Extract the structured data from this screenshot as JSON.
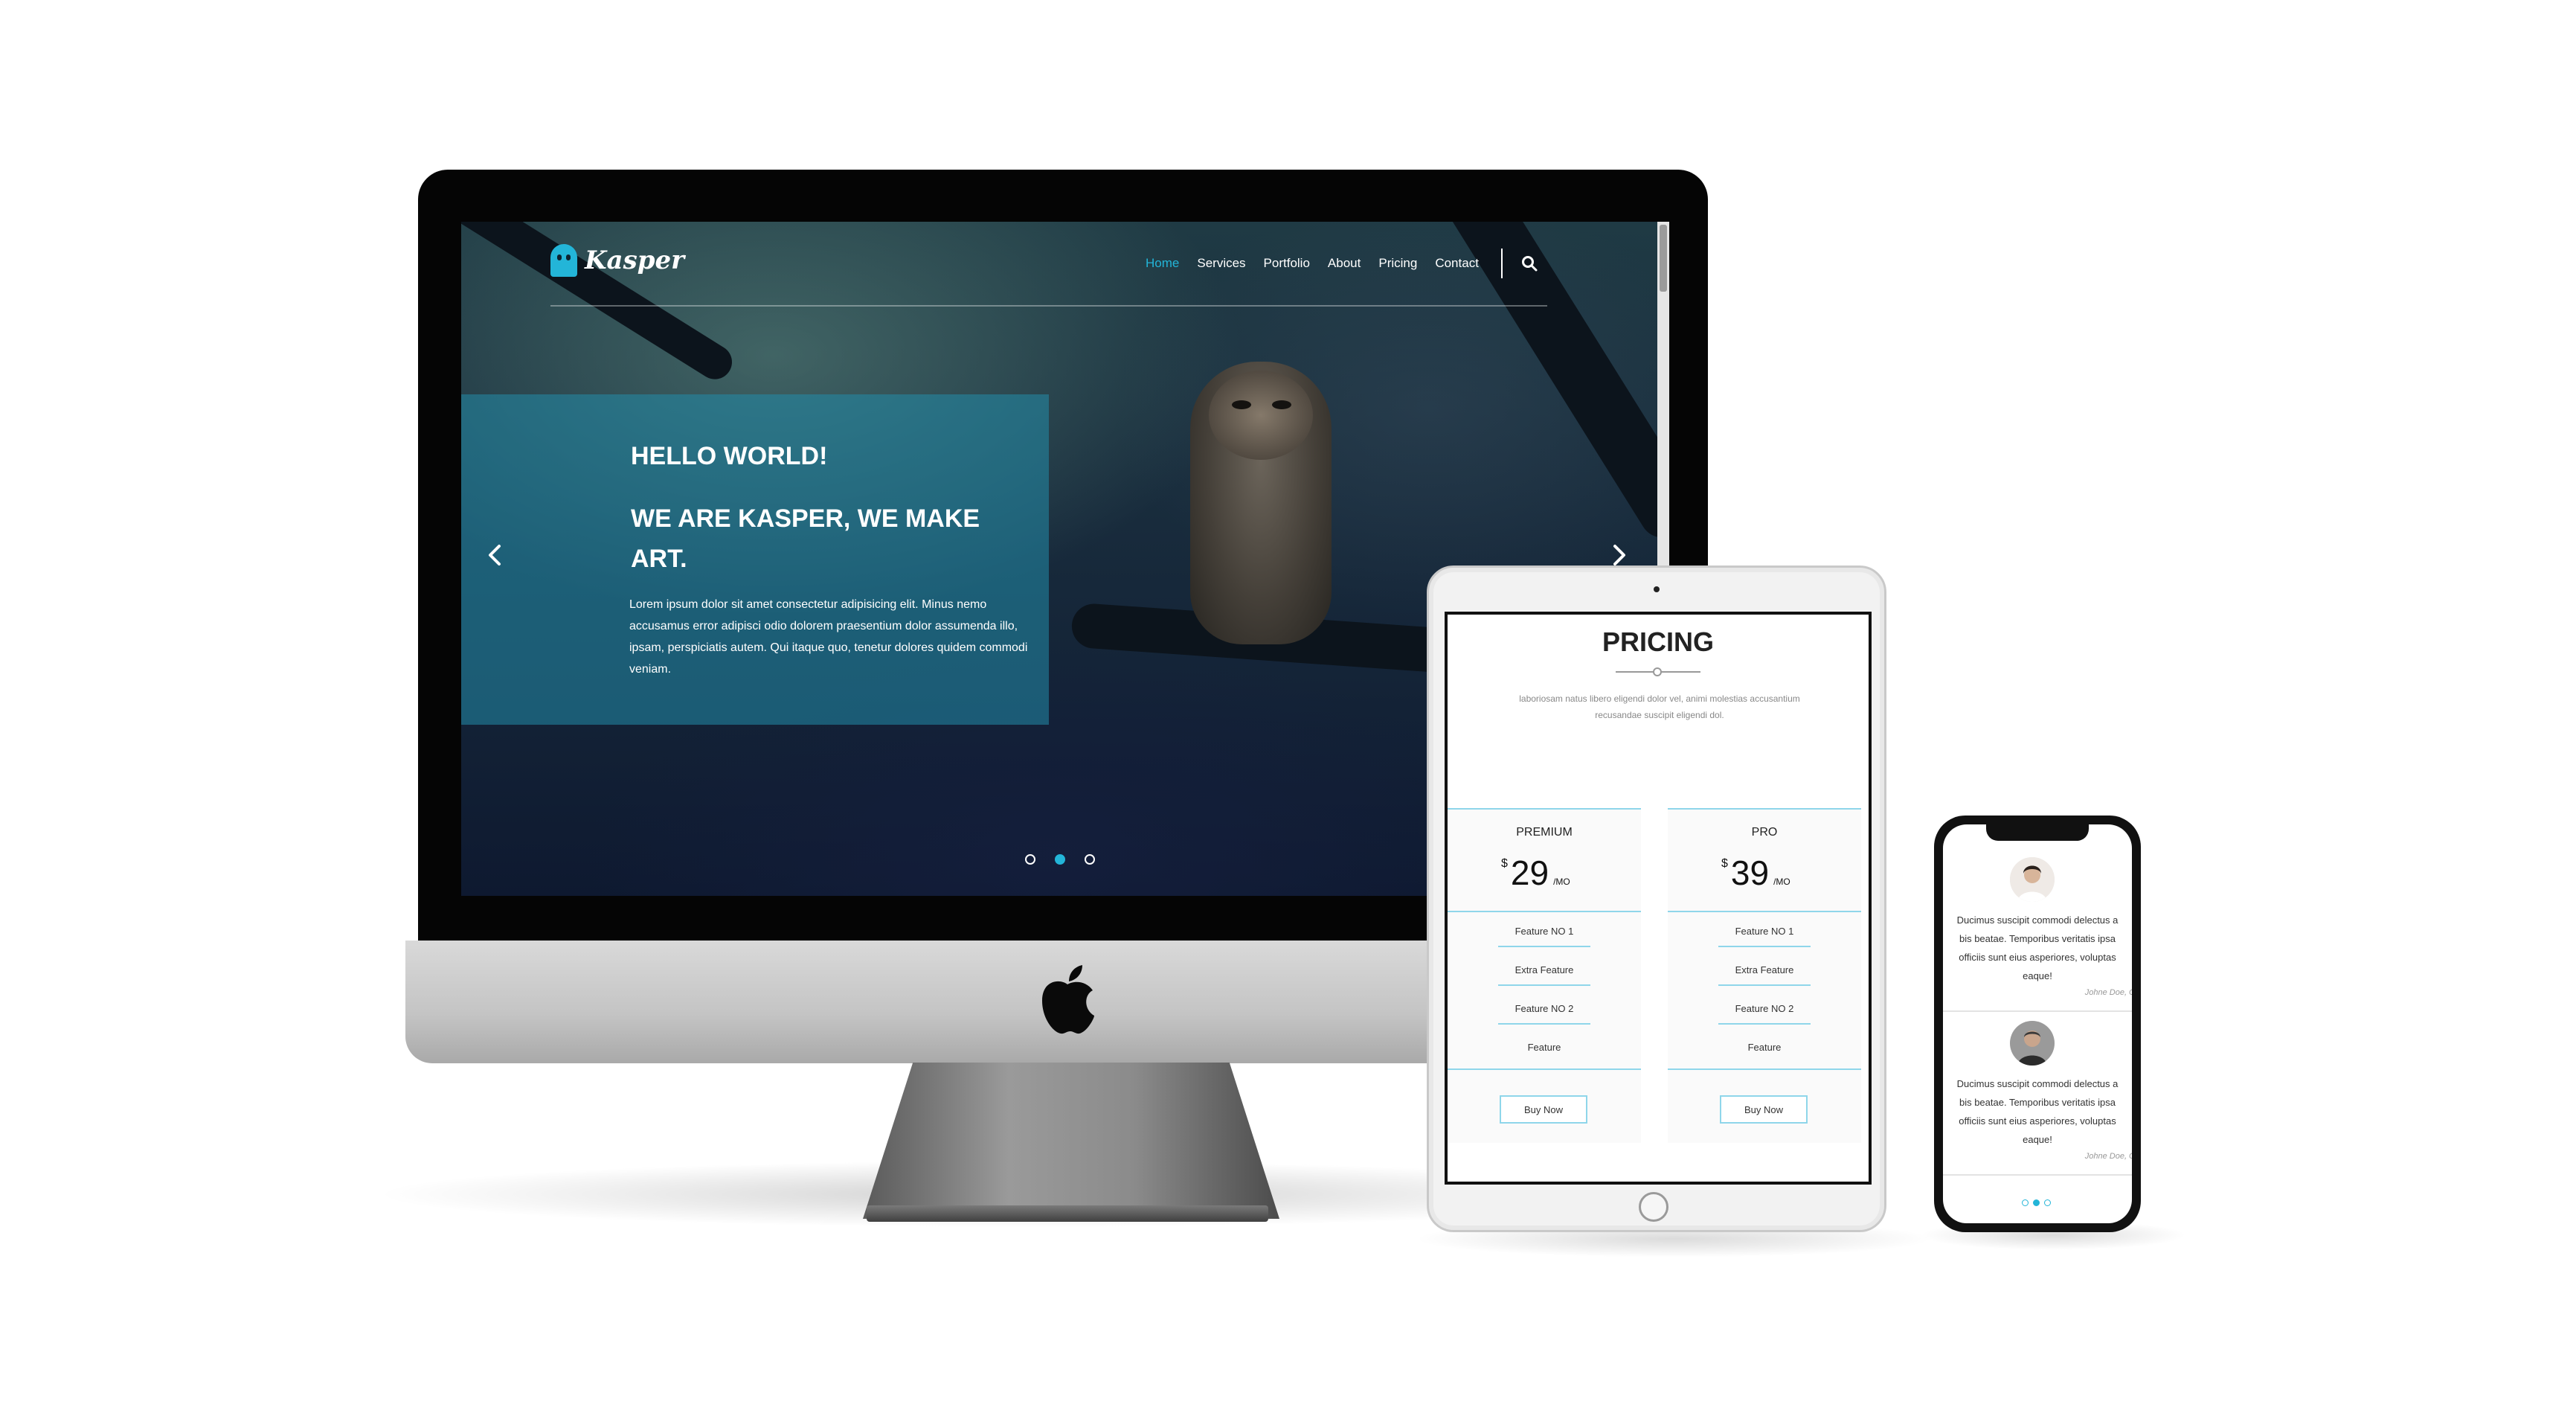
{
  "colors": {
    "accent": "#23b5d8",
    "hero_overlay": "rgba(35,140,170,0.55)",
    "divider_line": "#8fd6ea"
  },
  "desktop": {
    "logo_text": "Kasper",
    "nav": [
      {
        "label": "Home",
        "active": true
      },
      {
        "label": "Services",
        "active": false
      },
      {
        "label": "Portfolio",
        "active": false
      },
      {
        "label": "About",
        "active": false
      },
      {
        "label": "Pricing",
        "active": false
      },
      {
        "label": "Contact",
        "active": false
      }
    ],
    "search_icon": "search-icon",
    "hero": {
      "title_line1": "HELLO WORLD!",
      "title_line2": "WE ARE KASPER, WE MAKE ART.",
      "text": "Lorem ipsum dolor sit amet consectetur adipisicing elit. Minus nemo accusamus error adipisci odio dolorem praesentium dolor assumenda illo, ipsam, perspiciatis autem. Qui itaque quo, tenetur dolores quidem commodi veniam."
    },
    "slider": {
      "prev_icon": "chevron-left-icon",
      "next_icon": "chevron-right-icon",
      "dots": 3,
      "active_dot": 2
    }
  },
  "tablet": {
    "pricing": {
      "title": "PRICING",
      "description": "laboriosam natus libero eligendi dolor vel, animi molestias accusantium recusandae suscipit eligendi dol.",
      "plans": [
        {
          "name": "PREMIUM",
          "currency": "$",
          "price": "29",
          "period": "/MO",
          "features": [
            "Feature NO 1",
            "Extra Feature",
            "Feature NO 2",
            "Feature"
          ],
          "button": "Buy Now"
        },
        {
          "name": "PRO",
          "currency": "$",
          "price": "39",
          "period": "/MO",
          "features": [
            "Feature NO 1",
            "Extra Feature",
            "Feature NO 2",
            "Feature"
          ],
          "button": "Buy Now"
        }
      ]
    }
  },
  "phone": {
    "testimonials": [
      {
        "lines": [
          "Ducimus suscipit commodi delectus a",
          "bis beatae. Temporibus veritatis ipsa",
          "officiis sunt eius asperiores, voluptas",
          "eaque!"
        ],
        "author": "Johne Doe, C"
      },
      {
        "lines": [
          "Ducimus suscipit commodi delectus a",
          "bis beatae. Temporibus veritatis ipsa",
          "officiis sunt eius asperiores, voluptas",
          "eaque!"
        ],
        "author": "Johne Doe, C"
      }
    ],
    "dots": 3,
    "active_dot": 2
  }
}
